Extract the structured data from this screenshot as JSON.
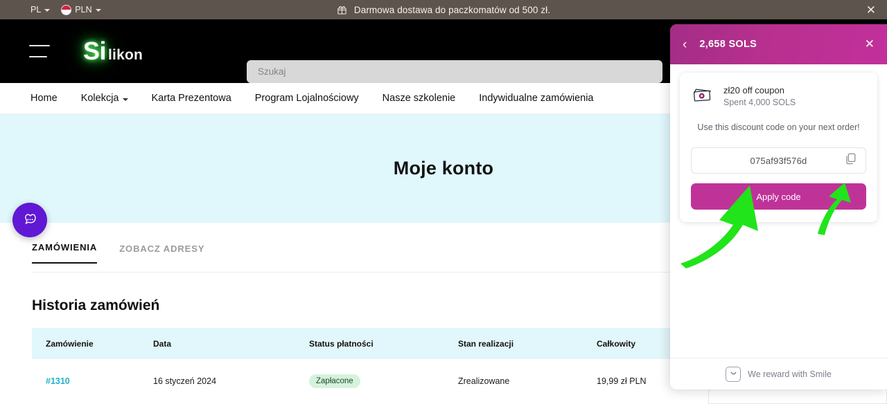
{
  "promo_bar": {
    "language": "PL",
    "currency": "PLN",
    "flag_icon": "flag-pl-icon",
    "gift_icon": "gift-icon",
    "message": "Darmowa dostawa do paczkomatów od 500 zł.",
    "close_icon": "✕"
  },
  "header": {
    "menu_icon": "hamburger-icon",
    "logo_primary": "Si",
    "logo_secondary": "likon",
    "search_placeholder": "Szukaj"
  },
  "nav": {
    "items": [
      {
        "label": "Home",
        "has_caret": false
      },
      {
        "label": "Kolekcja",
        "has_caret": true
      },
      {
        "label": "Karta Prezentowa",
        "has_caret": false
      },
      {
        "label": "Program Lojalnościowy",
        "has_caret": false
      },
      {
        "label": "Nasze szkolenie",
        "has_caret": false
      },
      {
        "label": "Indywidualne zamówienia",
        "has_caret": false
      }
    ]
  },
  "hero": {
    "title": "Moje konto",
    "background_color": "#e0f7fc"
  },
  "chat_widget": {
    "icon": "chat-bubble-icon",
    "color": "#6018d4"
  },
  "account": {
    "tabs": [
      {
        "label": "ZAMÓWIENIA",
        "active": true
      },
      {
        "label": "ZOBACZ ADRESY",
        "active": false
      }
    ],
    "section_title": "Historia zamówień",
    "table": {
      "columns": [
        "Zamówienie",
        "Data",
        "Status płatności",
        "Stan realizacji",
        "Całkowity"
      ],
      "rows": [
        {
          "order": "#1310",
          "date": "16 styczeń 2024",
          "payment_status": "Zapłacone",
          "fulfillment": "Zrealizowane",
          "total": "19,99 zł PLN"
        }
      ],
      "header_background": "#e2f7fb",
      "link_color": "#24b0c9",
      "badge_background": "#d5f2dd"
    }
  },
  "rewards_panel": {
    "back_icon": "chevron-left-icon",
    "points_label": "2,658 SOLS",
    "close_icon": "✕",
    "header_color": "#b8308f",
    "coupon": {
      "icon": "banknotes-icon",
      "title": "zł20 off coupon",
      "subtitle": "Spent 4,000 SOLS",
      "message": "Use this discount code on your next order!",
      "code": "075af93f576d",
      "copy_icon": "copy-icon",
      "apply_label": "Apply code",
      "apply_color": "#bf3399"
    },
    "footer": {
      "icon": "smile-badge-icon",
      "text": "We reward with Smile"
    }
  },
  "annotations": {
    "arrow_color": "#21e41a",
    "arrows": [
      {
        "name": "arrow-to-copy-icon",
        "target": "copy-icon"
      },
      {
        "name": "arrow-to-apply-code",
        "target": "apply-code-button"
      }
    ]
  }
}
